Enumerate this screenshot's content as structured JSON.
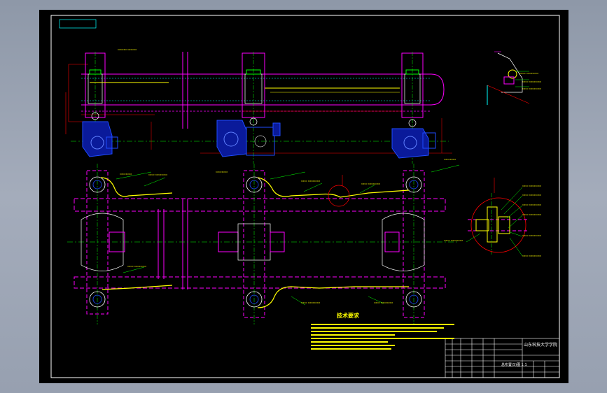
{
  "colors": {
    "background": "#000000",
    "frame": "#ffffff",
    "magenta": "#ff00ff",
    "green": "#00ff00",
    "yellow": "#ffff00",
    "red": "#ff0000",
    "cyan": "#00ffff",
    "blue": "#1f4bff",
    "grey": "#bbbbbb"
  },
  "notes": {
    "heading": "技术要求"
  },
  "title_block": {
    "school": "山东科技大学学院",
    "drawing_title": "总布置(S)图 1:1"
  }
}
